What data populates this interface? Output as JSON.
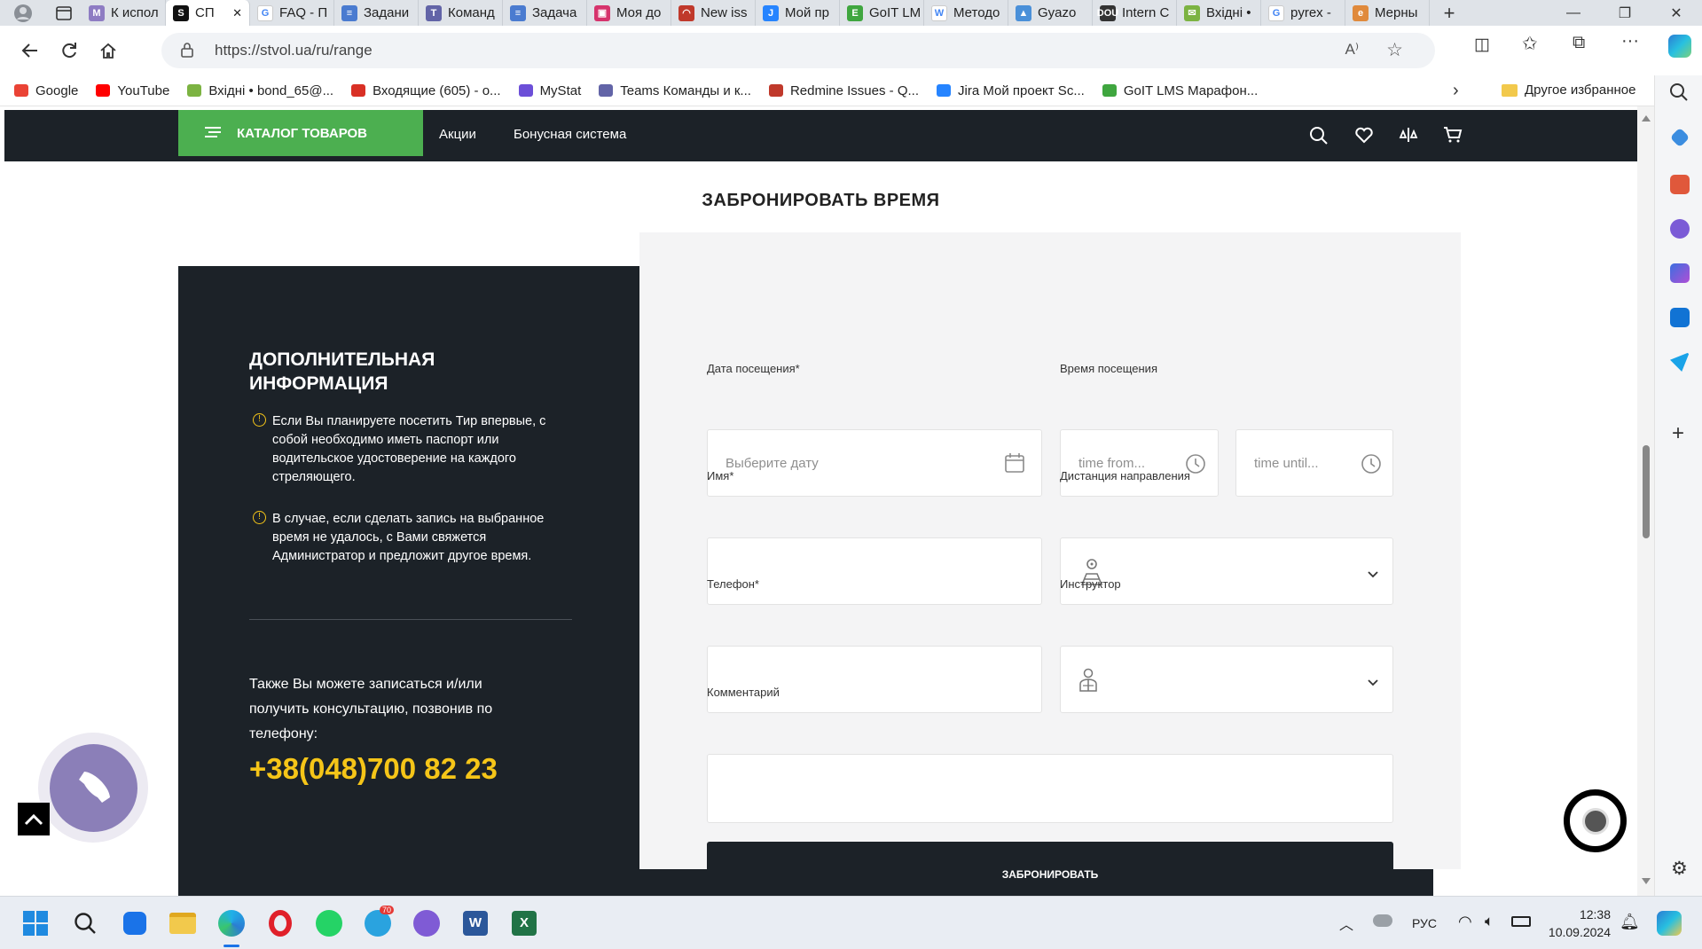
{
  "tabs": [
    {
      "label": "К испол",
      "fav_color": "#8e7cc3",
      "fav": "M"
    },
    {
      "label": "СП",
      "fav_color": "#111111",
      "fav": "S",
      "active": true
    },
    {
      "label": "FAQ - П",
      "fav_color": "#ffffff",
      "fav": "G"
    },
    {
      "label": "Задани",
      "fav_color": "#4a7bd0",
      "fav": "≡"
    },
    {
      "label": "Команд",
      "fav_color": "#6264a7",
      "fav": "T"
    },
    {
      "label": "Задача",
      "fav_color": "#4a7bd0",
      "fav": "≡"
    },
    {
      "label": "Моя до",
      "fav_color": "#d6336c",
      "fav": "▣"
    },
    {
      "label": "New iss",
      "fav_color": "#c0392b",
      "fav": "◠"
    },
    {
      "label": "Мой пр",
      "fav_color": "#2684ff",
      "fav": "J"
    },
    {
      "label": "GoIT LM",
      "fav_color": "#3fa63f",
      "fav": "E"
    },
    {
      "label": "Методо",
      "fav_color": "#ffffff",
      "fav": "W"
    },
    {
      "label": "Gyazo",
      "fav_color": "#4a90d9",
      "fav": "▲"
    },
    {
      "label": "Intern C",
      "fav_color": "#333333",
      "fav": "DOU"
    },
    {
      "label": "Вхідні •",
      "fav_color": "#7cb342",
      "fav": "✉"
    },
    {
      "label": "pyrex -",
      "fav_color": "#ffffff",
      "fav": "G"
    },
    {
      "label": "Мерны",
      "fav_color": "#e08a3c",
      "fav": "e"
    }
  ],
  "url": "https://stvol.ua/ru/range",
  "bookmarks": [
    {
      "label": "Google",
      "color": "#ea4335"
    },
    {
      "label": "YouTube",
      "color": "#ff0000"
    },
    {
      "label": "Вхідні • bond_65@...",
      "color": "#7cb342"
    },
    {
      "label": "Входящие (605) - о...",
      "color": "#d93025"
    },
    {
      "label": "MyStat",
      "color": "#6c4fd8"
    },
    {
      "label": "Teams Команды и к...",
      "color": "#6264a7"
    },
    {
      "label": "Redmine  Issues - Q...",
      "color": "#c0392b"
    },
    {
      "label": "Jira  Мой проект Sc...",
      "color": "#2684ff"
    },
    {
      "label": "GoIT LMS Марафон...",
      "color": "#3fa63f"
    }
  ],
  "bookmarks_other": "Другое избранное",
  "site": {
    "catalog": "КАТАЛОГ ТОВАРОВ",
    "nav": [
      "Акции",
      "Бонусная система"
    ],
    "title": "ЗАБРОНИРОВАТЬ ВРЕМЯ"
  },
  "info": {
    "heading_1": "ДОПОЛНИТЕЛЬНАЯ",
    "heading_2": "ИНФОРМАЦИЯ",
    "note_1": "Если Вы планируете посетить Тир впервые, с собой необходимо иметь паспорт или водительское удостоверение на каждого стреляющего.",
    "note_2": "В случае, если сделать запись на выбранное время не удалось, с Вами свяжется Администратор и предложит другое время.",
    "call_text": "Также Вы можете записаться и/или получить консультацию, позвонив по телефону:",
    "phone": "+38(048)700 82 23",
    "phone_color": "#f5c518"
  },
  "form": {
    "date_label": "Дата посещения*",
    "date_placeholder": "Выберите дату",
    "time_label": "Время посещения",
    "time_from_placeholder": "time from...",
    "time_until_placeholder": "time until...",
    "name_label": "Имя*",
    "distance_label": "Дистанция направления",
    "phone_label": "Телефон*",
    "instructor_label": "Инструктор",
    "comment_label": "Комментарий",
    "submit": "ЗАБРОНИРОВАТЬ"
  },
  "taskbar": {
    "lang": "РУС",
    "time": "12:38",
    "date": "10.09.2024",
    "telegram_badge": "70"
  },
  "colors": {
    "accent_green": "#4caf50",
    "dark_bg": "#1c2228",
    "call_widget": "#8b7fb8"
  }
}
